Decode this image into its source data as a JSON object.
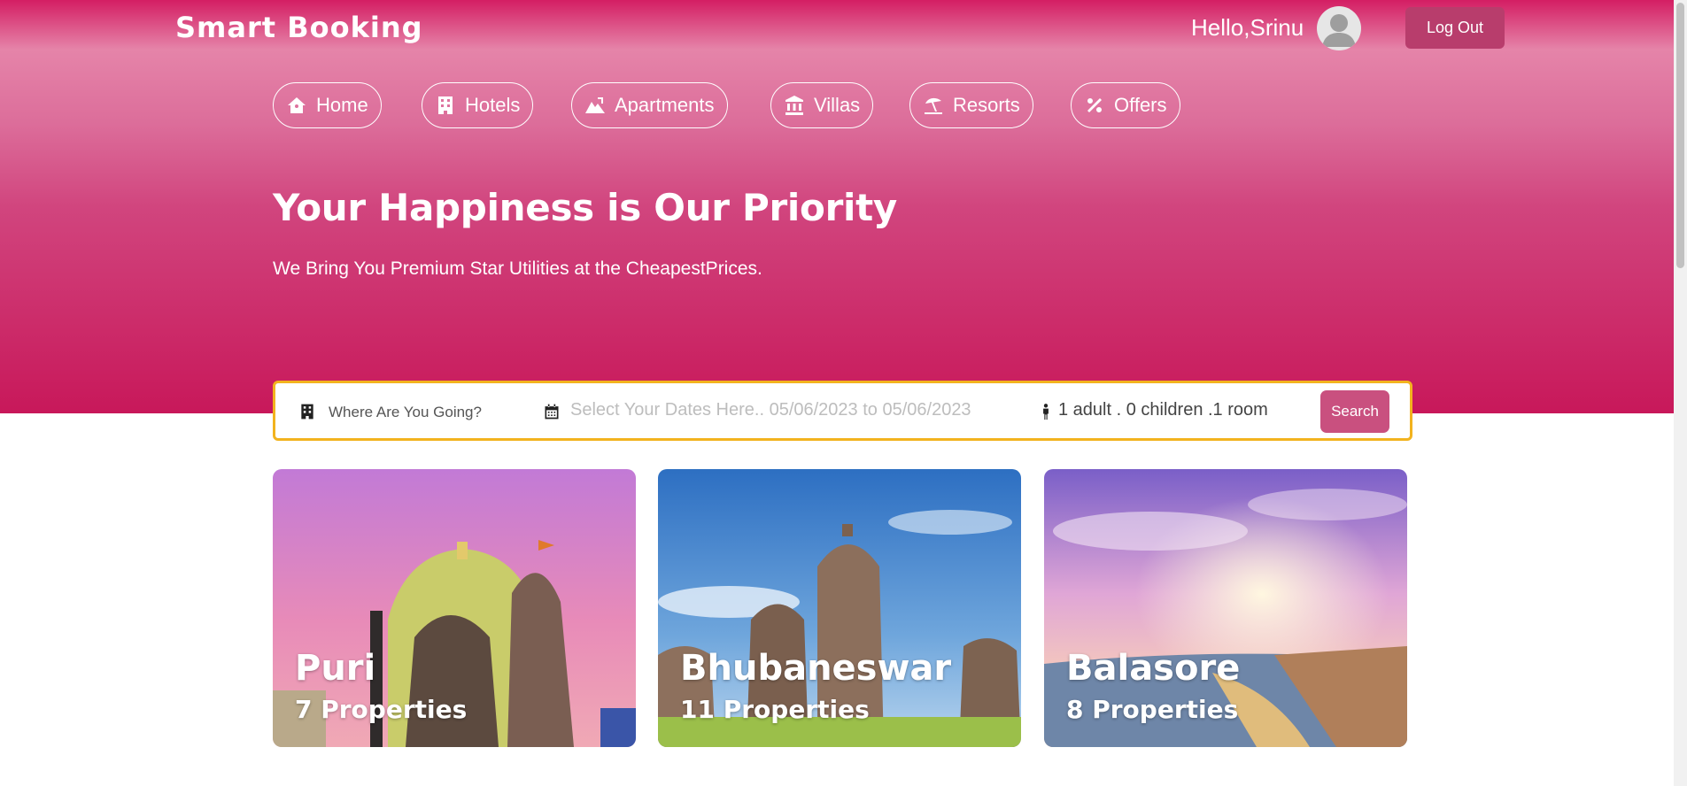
{
  "header": {
    "logo": "Smart Booking",
    "greeting": "Hello,Srinu",
    "logout_label": "Log Out"
  },
  "nav": {
    "items": [
      {
        "label": "Home",
        "icon": "house-icon"
      },
      {
        "label": "Hotels",
        "icon": "building-icon"
      },
      {
        "label": "Apartments",
        "icon": "mountain-city-icon"
      },
      {
        "label": "Villas",
        "icon": "landmark-icon"
      },
      {
        "label": "Resorts",
        "icon": "umbrella-beach-icon"
      },
      {
        "label": "Offers",
        "icon": "percent-icon"
      }
    ]
  },
  "hero": {
    "title": "Your Happiness is Our Priority",
    "subtitle": "We Bring You Premium Star Utilities at the CheapestPrices."
  },
  "search": {
    "destination_placeholder": "Where Are You Going?",
    "dates_text": "Select Your Dates Here..  05/06/2023 to 05/06/2023",
    "guests_text": "1 adult . 0 children .1 room",
    "search_label": "Search"
  },
  "destinations": [
    {
      "name": "Puri",
      "properties": "7 Properties"
    },
    {
      "name": "Bhubaneswar",
      "properties": "11 Properties"
    },
    {
      "name": "Balasore",
      "properties": "8 Properties"
    }
  ],
  "colors": {
    "brand": "#d41e63",
    "button": "#b83d6c",
    "search_border": "#f2b31e",
    "search_button": "#c9507f"
  }
}
